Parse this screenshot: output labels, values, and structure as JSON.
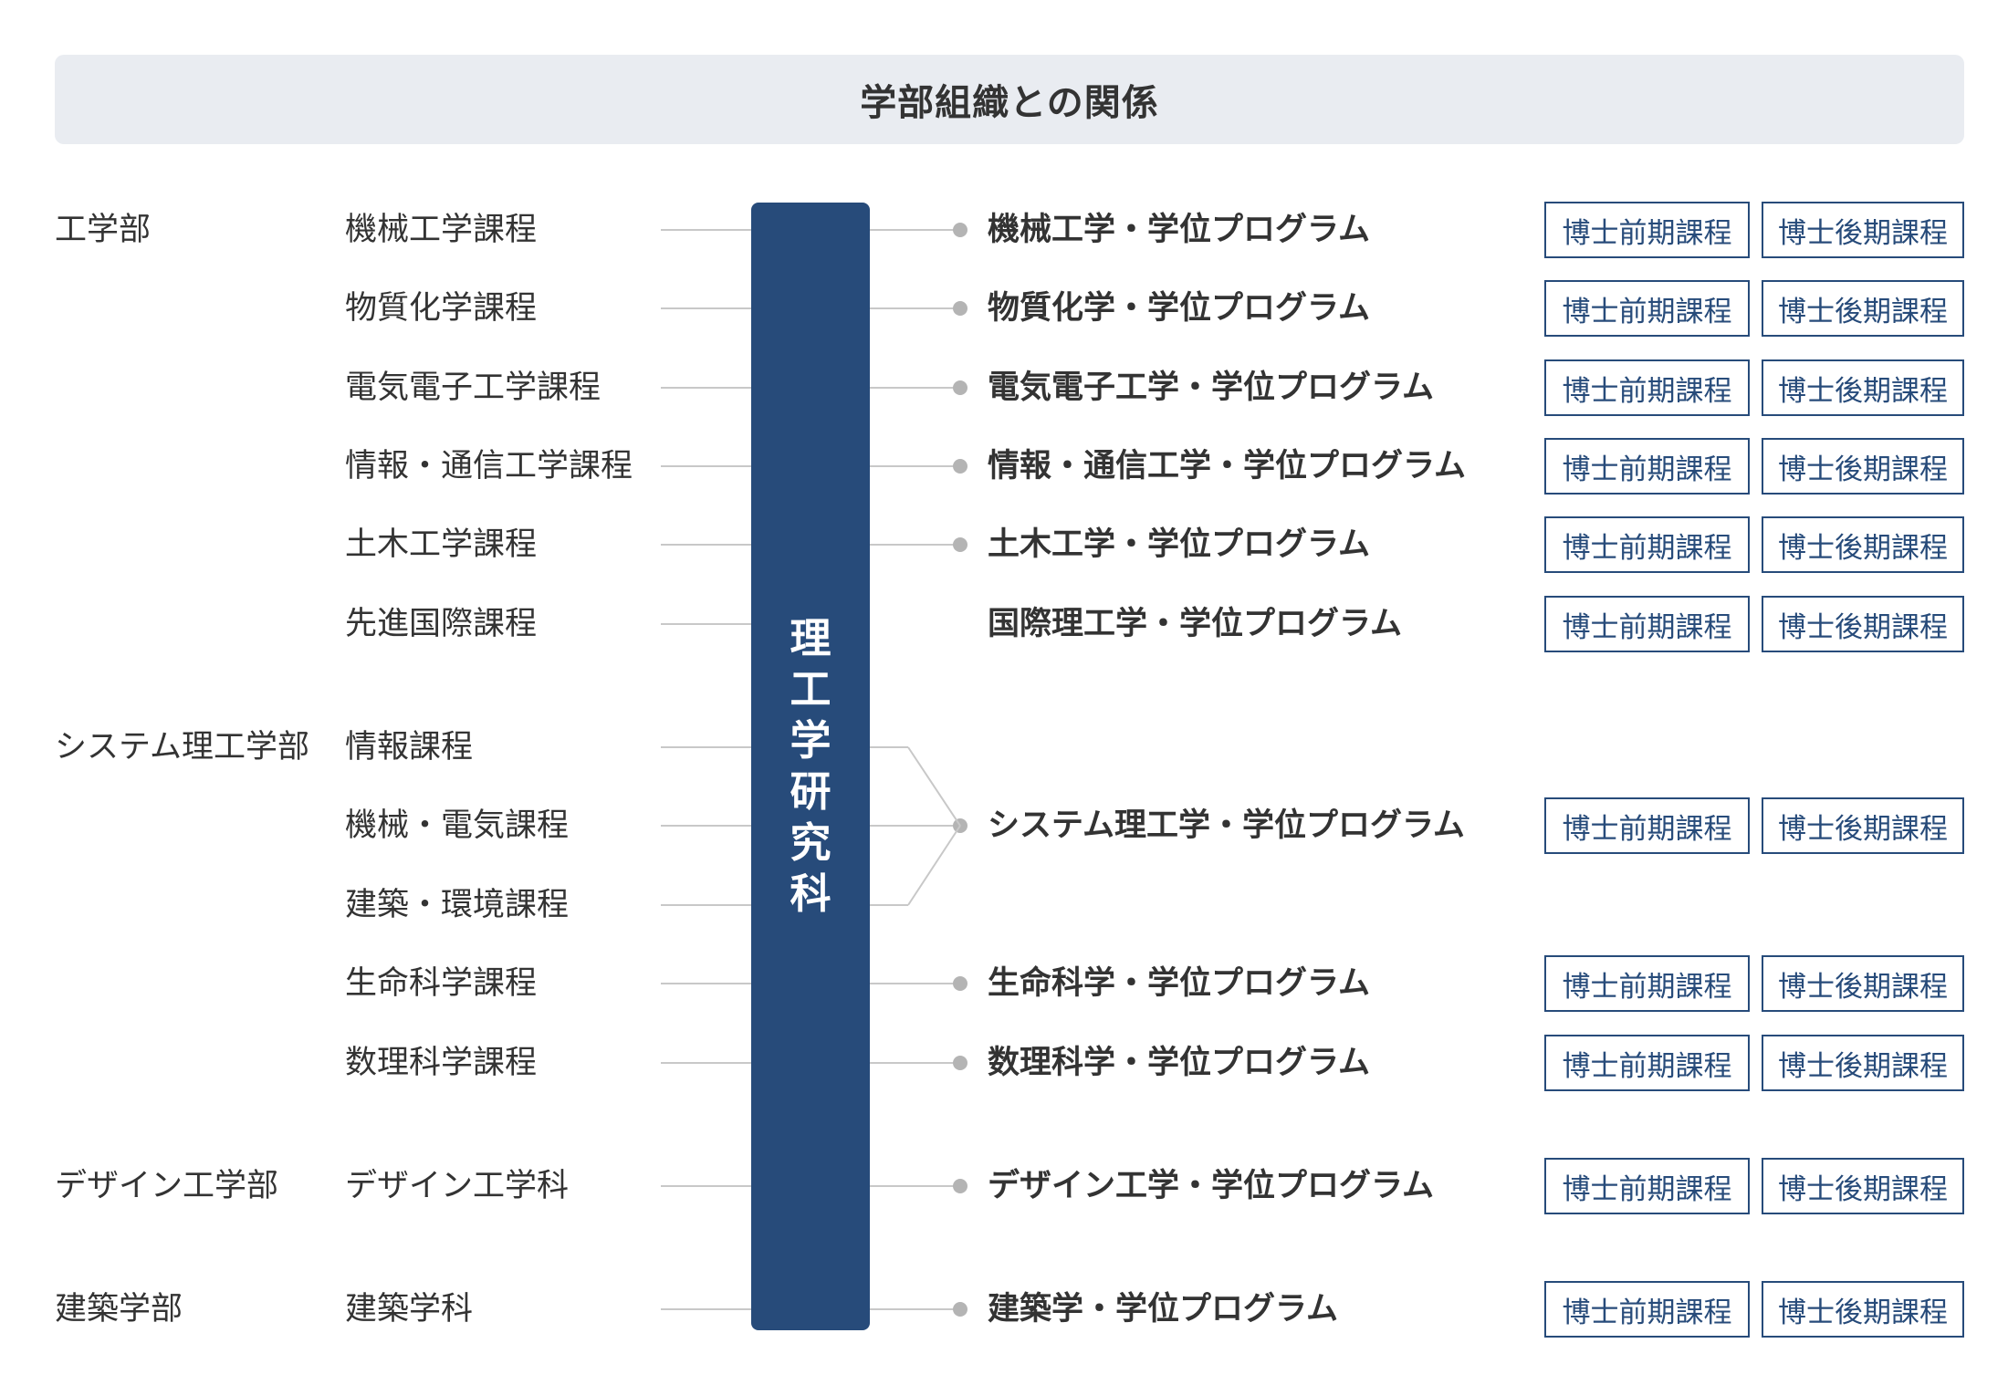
{
  "title": "学部組織との関係",
  "center": "理工学研究科",
  "colors": {
    "navy": "#274b7a",
    "header_bg": "#e9ecf1",
    "text": "#333333",
    "line": "#c8c8c8",
    "dot": "#b4b4b4"
  },
  "badges": {
    "first": "博士前期課程",
    "second": "博士後期課程"
  },
  "rows": [
    {
      "faculty": "工学部",
      "course": "機械工学課程",
      "program": "機械工学・学位プログラム",
      "badges": true,
      "dot": true
    },
    {
      "faculty": "",
      "course": "物質化学課程",
      "program": "物質化学・学位プログラム",
      "badges": true,
      "dot": true
    },
    {
      "faculty": "",
      "course": "電気電子工学課程",
      "program": "電気電子工学・学位プログラム",
      "badges": true,
      "dot": true
    },
    {
      "faculty": "",
      "course": "情報・通信工学課程",
      "program": "情報・通信工学・学位プログラム",
      "badges": true,
      "dot": true
    },
    {
      "faculty": "",
      "course": "土木工学課程",
      "program": "土木工学・学位プログラム",
      "badges": true,
      "dot": true
    },
    {
      "faculty": "",
      "course": "先進国際課程",
      "program": "国際理工学・学位プログラム",
      "badges": true,
      "dot": false
    },
    {
      "faculty": "システム理工学部",
      "course": "情報課程",
      "program": "",
      "badges": false,
      "dot": false
    },
    {
      "faculty": "",
      "course": "機械・電気課程",
      "program": "システム理工学・学位プログラム",
      "badges": true,
      "dot": true
    },
    {
      "faculty": "",
      "course": "建築・環境課程",
      "program": "",
      "badges": false,
      "dot": false
    },
    {
      "faculty": "",
      "course": "生命科学課程",
      "program": "生命科学・学位プログラム",
      "badges": true,
      "dot": true
    },
    {
      "faculty": "",
      "course": "数理科学課程",
      "program": "数理科学・学位プログラム",
      "badges": true,
      "dot": true
    },
    {
      "faculty": "デザイン工学部",
      "course": "デザイン工学科",
      "program": "デザイン工学・学位プログラム",
      "badges": true,
      "dot": true
    },
    {
      "faculty": "建築学部",
      "course": "建築学科",
      "program": "建築学・学位プログラム",
      "badges": true,
      "dot": true
    }
  ]
}
